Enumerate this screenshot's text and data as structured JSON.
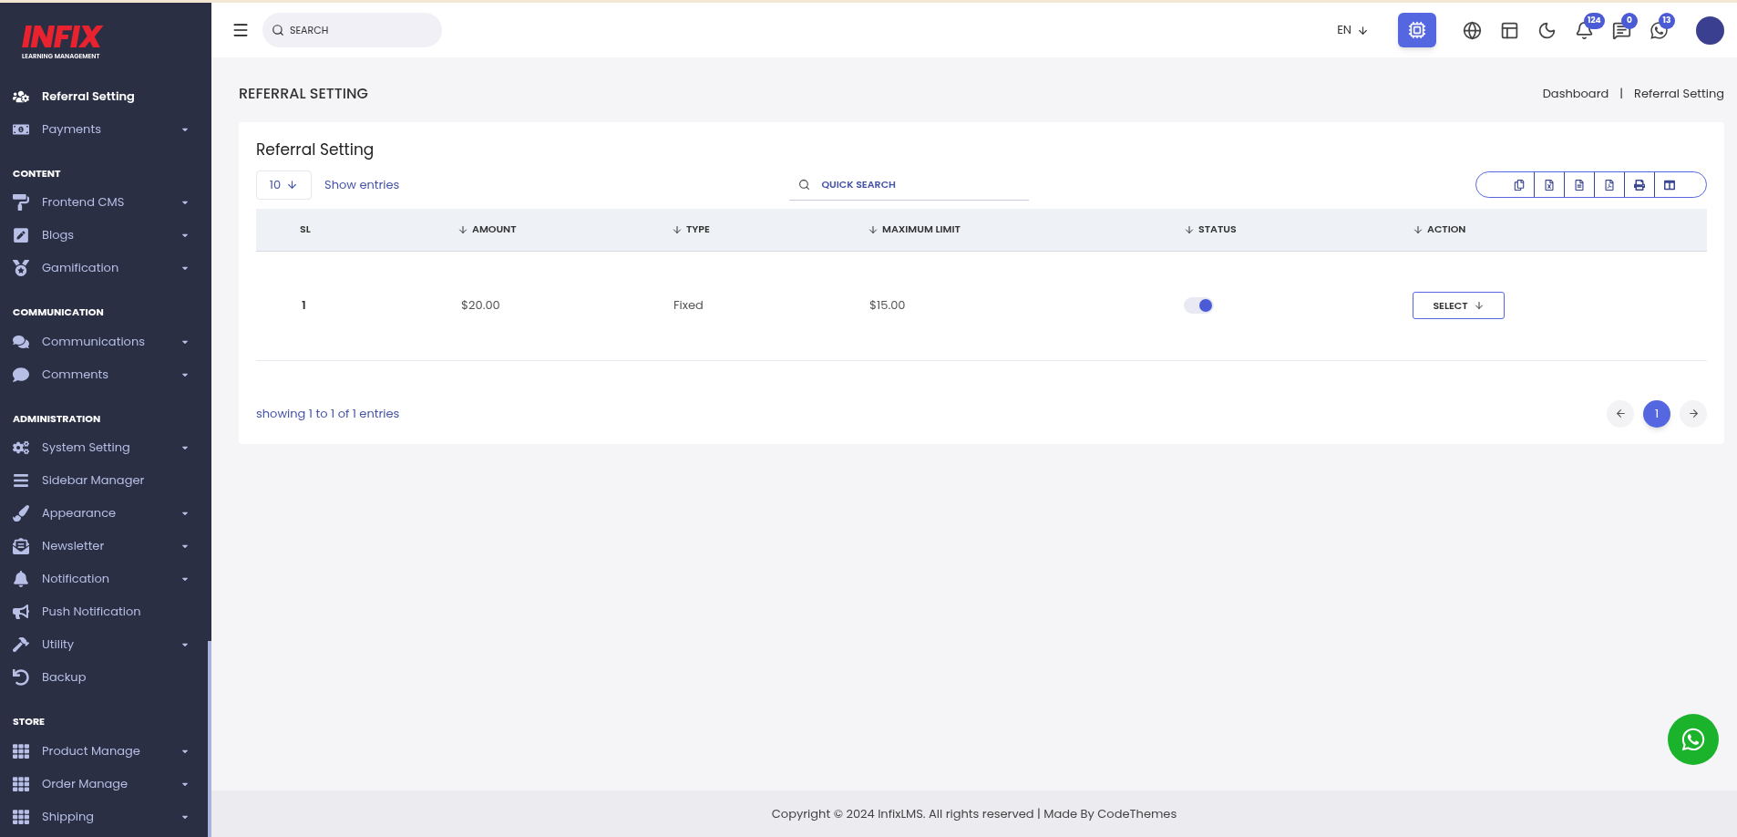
{
  "logo": {
    "name": "INFIX",
    "tagline": "LEARNING MANAGEMENT"
  },
  "sidebar": {
    "sections": [
      {
        "items": [
          {
            "label": "Referral Setting",
            "selected": true,
            "has_submenu": false
          },
          {
            "label": "Payments",
            "selected": false,
            "has_submenu": true
          }
        ]
      },
      {
        "heading": "CONTENT",
        "items": [
          {
            "label": "Frontend CMS",
            "selected": false,
            "has_submenu": true
          },
          {
            "label": "Blogs",
            "selected": false,
            "has_submenu": true
          },
          {
            "label": "Gamification",
            "selected": false,
            "has_submenu": true
          }
        ]
      },
      {
        "heading": "COMMUNICATION",
        "items": [
          {
            "label": "Communications",
            "selected": false,
            "has_submenu": true
          },
          {
            "label": "Comments",
            "selected": false,
            "has_submenu": true
          }
        ]
      },
      {
        "heading": "ADMINISTRATION",
        "items": [
          {
            "label": "System Setting",
            "selected": false,
            "has_submenu": true
          },
          {
            "label": "Sidebar Manager",
            "selected": false,
            "has_submenu": false
          },
          {
            "label": "Appearance",
            "selected": false,
            "has_submenu": true
          },
          {
            "label": "Newsletter",
            "selected": false,
            "has_submenu": true
          },
          {
            "label": "Notification",
            "selected": false,
            "has_submenu": true
          },
          {
            "label": "Push Notification",
            "selected": false,
            "has_submenu": false
          },
          {
            "label": "Utility",
            "selected": false,
            "has_submenu": true
          },
          {
            "label": "Backup",
            "selected": false,
            "has_submenu": false
          }
        ]
      },
      {
        "heading": "STORE",
        "items": [
          {
            "label": "Product Manage",
            "selected": false,
            "has_submenu": true
          },
          {
            "label": "Order Manage",
            "selected": false,
            "has_submenu": true
          },
          {
            "label": "Shipping",
            "selected": false,
            "has_submenu": true
          }
        ]
      }
    ]
  },
  "topbar": {
    "search": {
      "placeholder": "SEARCH"
    },
    "language": "EN",
    "badges": {
      "notifications": "124",
      "messages": "0",
      "chats": "13"
    }
  },
  "page": {
    "title": "REFERRAL SETTING",
    "breadcrumb": [
      "Dashboard",
      "Referral Setting"
    ],
    "breadcrumb_separator": "|"
  },
  "card": {
    "title": "Referral Setting",
    "page_size": "10",
    "show_entries": "Show entries",
    "quick_search": {
      "placeholder": "QUICK SEARCH"
    },
    "table": {
      "columns": [
        {
          "label": "SL",
          "sortable": false
        },
        {
          "label": "AMOUNT",
          "sortable": true
        },
        {
          "label": "TYPE",
          "sortable": true
        },
        {
          "label": "MAXIMUM LIMIT",
          "sortable": true
        },
        {
          "label": "STATUS",
          "sortable": true
        },
        {
          "label": "ACTION",
          "sortable": true
        }
      ],
      "rows": [
        {
          "sl": "1",
          "amount": "$20.00",
          "type": "Fixed",
          "maximum_limit": "$15.00",
          "status_on": true,
          "action": "SELECT"
        }
      ]
    },
    "info": "showing 1 to 1 of 1 entries",
    "pages": [
      {
        "label": "1",
        "selected": true
      }
    ]
  },
  "footer": {
    "copyright": "Copyright © 2024 InfixLMS. All rights reserved | Made By CodeThemes"
  }
}
